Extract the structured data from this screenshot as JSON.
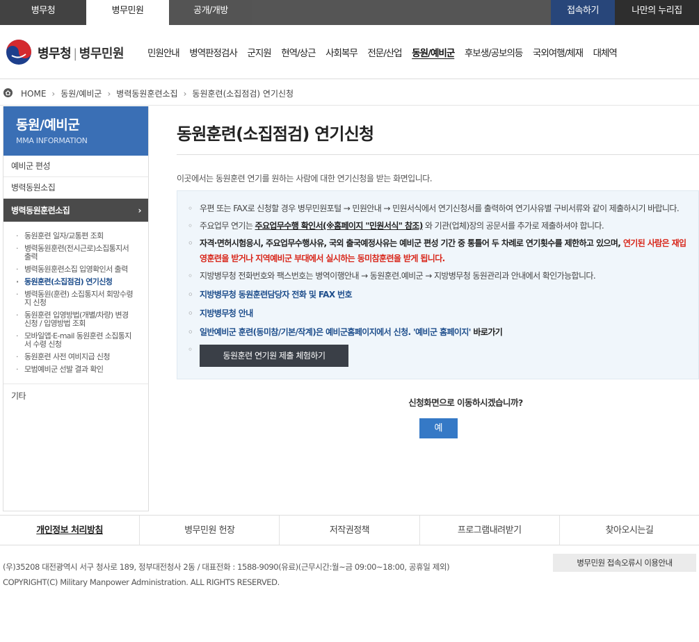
{
  "topbar": {
    "tabs": [
      "병무청",
      "병무민원",
      "공개/개방"
    ],
    "login": "접속하기",
    "mypage": "나만의 누리집"
  },
  "header": {
    "logo_main": "병무청",
    "logo_sub": "병무민원",
    "menu": [
      "민원안내",
      "병역판정검사",
      "군지원",
      "현역/상근",
      "사회복무",
      "전문/산업",
      "동원/예비군",
      "후보생/공보의등",
      "국외여행/체재",
      "대체역"
    ]
  },
  "breadcrumb": [
    "HOME",
    "동원/예비군",
    "병력동원훈련소집",
    "동원훈련(소집점검) 연기신청"
  ],
  "sidebar": {
    "title": "동원/예비군",
    "subtitle": "MMA INFORMATION",
    "items": [
      "예비군 편성",
      "병력동원소집",
      "병력동원훈련소집"
    ],
    "subitems": [
      "동원훈련 일자/교통편 조회",
      "병력동원훈련(전시근로)소집통지서 출력",
      "병력동원훈련소집 입영확인서 출력",
      "동원훈련(소집점검) 연기신청",
      "병력동원(훈련) 소집통지서 회망수령지 신청",
      "동원훈련 입영방법(개별/차량) 변경 신청 / 입영방법 조회",
      "모바일앱·E-mail 동원훈련 소집통지서 수령 신청",
      "동원훈련 사전 여비지급 신청",
      "모범예비군 선발 결과 확인"
    ],
    "etc": "기타"
  },
  "main": {
    "title": "동원훈련(소집점검) 연기신청",
    "intro": "이곳에서는 동원훈련 연기를 원하는 사람에 대한 연기신청을 받는 화면입니다.",
    "notice1": "우편 또는 FAX로 신청할 경우 병무민원포털 → 민원안내 → 민원서식에서 연기신청서를 출력하여 연기사유별 구비서류와 같이 제출하시기 바랍니다.",
    "notice2_pre": "주요업무 연기는 ",
    "notice2_link": "주요업무수행 확인서(※홈페이지 \"민원서식\" 참조)",
    "notice2_post": " 와 기관(업체)장의 공문서를 추가로 제출하셔야 합니다.",
    "notice3_bold": "자격·면허시험응시, 주요업무수행사유, 국외 출국예정사유는 예비군 편성 기간 중 통틀어 두 차례로 연기횟수를 제한하고 있으며, ",
    "notice3_red": "연기된 사람은 재입영훈련을 받거나 지역예비군 부대에서 실시하는 동미참훈련을 받게 됩니다.",
    "notice4": "지방병무청 전화번호와 팩스번호는 병역이행안내 → 동원훈련.예비군 → 지방병무청 동원관리과 안내에서 확인가능합니다.",
    "link1": "지방병무청 동원훈련담당자 전화 및 FAX 번호",
    "link2": "지방병무청 안내",
    "link3_blue": "일반예비군 훈련(동미참/기본/작계)은 예비군홈페이지에서 신청. '예비군 홈페이지'",
    "link3_black": " 바로가기",
    "try_button": "동원훈련 연기원 제출 체험하기",
    "confirm": "신청화면으로 이동하시겠습니까?",
    "yes": "예"
  },
  "footer": {
    "links": [
      "개인정보 처리방침",
      "병무민원 헌장",
      "저작권정책",
      "프로그램내려받기",
      "찾아오시는길"
    ],
    "address": "(우)35208 대전광역시 서구 청사로 189, 정부대전청사 2동 / 대표전화 : 1588-9090(유료)(근무시간:월~금 09:00~18:00, 공휴일 제외)",
    "copyright": "COPYRIGHT(C) Military Manpower Administration. ALL RIGHTS RESERVED.",
    "error_guide": "병무민원 접속오류시 이용안내"
  }
}
